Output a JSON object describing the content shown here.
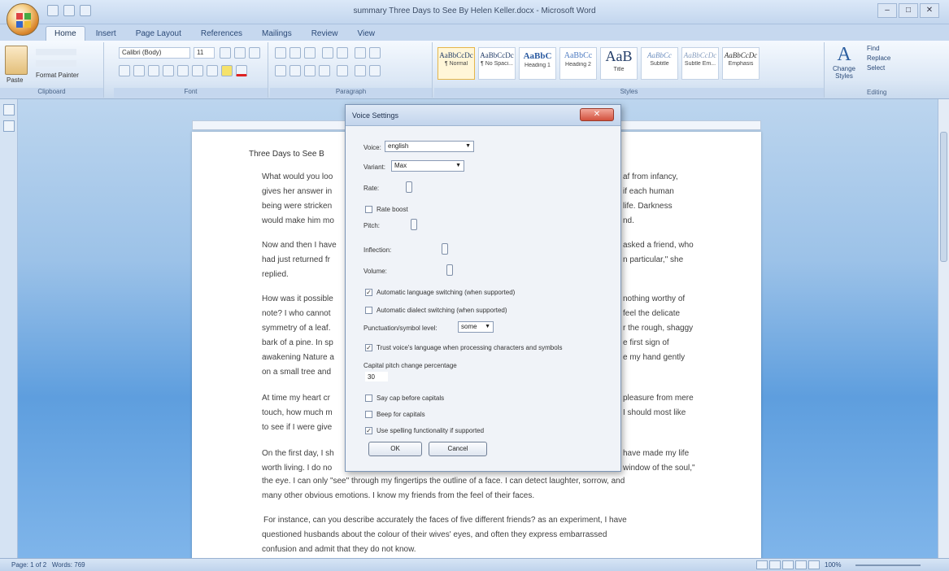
{
  "window": {
    "title": "summary Three Days to See By Helen Keller.docx - Microsoft Word",
    "controls": [
      "–",
      "□",
      "✕"
    ]
  },
  "tabs": [
    "Home",
    "Insert",
    "Page Layout",
    "References",
    "Mailings",
    "Review",
    "View"
  ],
  "ribbon": {
    "clipboard": {
      "paste": "Paste",
      "format_painter": "Format Painter",
      "label": "Clipboard"
    },
    "font": {
      "name": "Calibri (Body)",
      "size": "11",
      "label": "Font"
    },
    "paragraph": {
      "label": "Paragraph"
    },
    "styles": {
      "items": [
        {
          "sample": "AaBbCcDc",
          "name": "¶ Normal"
        },
        {
          "sample": "AaBbCcDc",
          "name": "¶ No Spaci..."
        },
        {
          "sample": "AaBbC",
          "name": "Heading 1"
        },
        {
          "sample": "AaBbCc",
          "name": "Heading 2"
        },
        {
          "sample": "AaB",
          "name": "Title"
        },
        {
          "sample": "AaBbCc",
          "name": "Subtitle"
        },
        {
          "sample": "AaBbCcDc",
          "name": "Subtle Em..."
        },
        {
          "sample": "AaBbCcDc",
          "name": "Emphasis"
        }
      ],
      "label": "Styles",
      "change_styles": "Change Styles"
    },
    "editing": {
      "find": "Find",
      "replace": "Replace",
      "select": "Select",
      "label": "Editing"
    }
  },
  "document": {
    "title": "Three Days to See B",
    "lines": [
      {
        "left": "What would you loo",
        "right": "af from infancy,"
      },
      {
        "left": "gives her answer in",
        "right": "if each human"
      },
      {
        "left": "being were stricken",
        "right": "life. Darkness"
      },
      {
        "left": "would make him mo",
        "right": "nd."
      },
      {
        "left": "Now and then I have",
        "right": "asked a friend, who"
      },
      {
        "left": "had just returned fr",
        "right": "n particular,\" she"
      },
      {
        "left": "replied.",
        "right": ""
      },
      {
        "left": "How was it possible",
        "right": "nothing worthy of"
      },
      {
        "left": "note? I who cannot",
        "right": "feel the delicate"
      },
      {
        "left": "symmetry of a leaf.",
        "right": "r the rough, shaggy"
      },
      {
        "left": "bark of a pine. In sp",
        "right": "e first sign of"
      },
      {
        "left": "awakening Nature a",
        "right": "e my hand gently"
      },
      {
        "left": "on a small tree and",
        "right": ""
      },
      {
        "left": "At time my heart cr",
        "right": "pleasure from mere"
      },
      {
        "left": "touch, how much m",
        "right": "I should most like"
      },
      {
        "left": "to see if I were give",
        "right": ""
      },
      {
        "left": "On the first day, I sh",
        "right": "have made my life"
      },
      {
        "left": "worth living. I do no",
        "right": "window of the soul,\""
      }
    ],
    "full_lines": [
      "the eye. I can only \"see\" through my fingertips the outline of a face. I can detect laughter, sorrow, and",
      "many other obvious emotions. I know my friends from the feel of their faces.",
      "For instance, can you describe accurately the faces of five different friends? as an experiment, I have",
      "questioned husbands about the colour of their wives' eyes, and often they express embarrassed",
      "confusion and admit that they do not know."
    ]
  },
  "dialog": {
    "title": "Voice Settings",
    "close": "✕",
    "voice_label": "Voice:",
    "voice_value": "english",
    "variant_label": "Variant:",
    "variant_value": "Max",
    "rate_label": "Rate:",
    "rate_boost_label": "Rate boost",
    "pitch_label": "Pitch:",
    "inflection_label": "Inflection:",
    "volume_label": "Volume:",
    "auto_lang_label": "Automatic language switching (when supported)",
    "auto_dialect_label": "Automatic dialect switching (when supported)",
    "punct_label": "Punctuation/symbol level:",
    "punct_value": "some",
    "trust_voice_label": "Trust voice's language when processing characters and symbols",
    "cap_pitch_label": "Capital pitch change percentage",
    "cap_pitch_value": "30",
    "say_cap_label": "Say cap before capitals",
    "beep_cap_label": "Beep for capitals",
    "spelling_label": "Use spelling functionality if supported",
    "ok": "OK",
    "cancel": "Cancel",
    "checked_mark": "✓"
  },
  "status": {
    "page": "Page: 1 of 2",
    "words": "Words: 769",
    "zoom": "100%"
  }
}
